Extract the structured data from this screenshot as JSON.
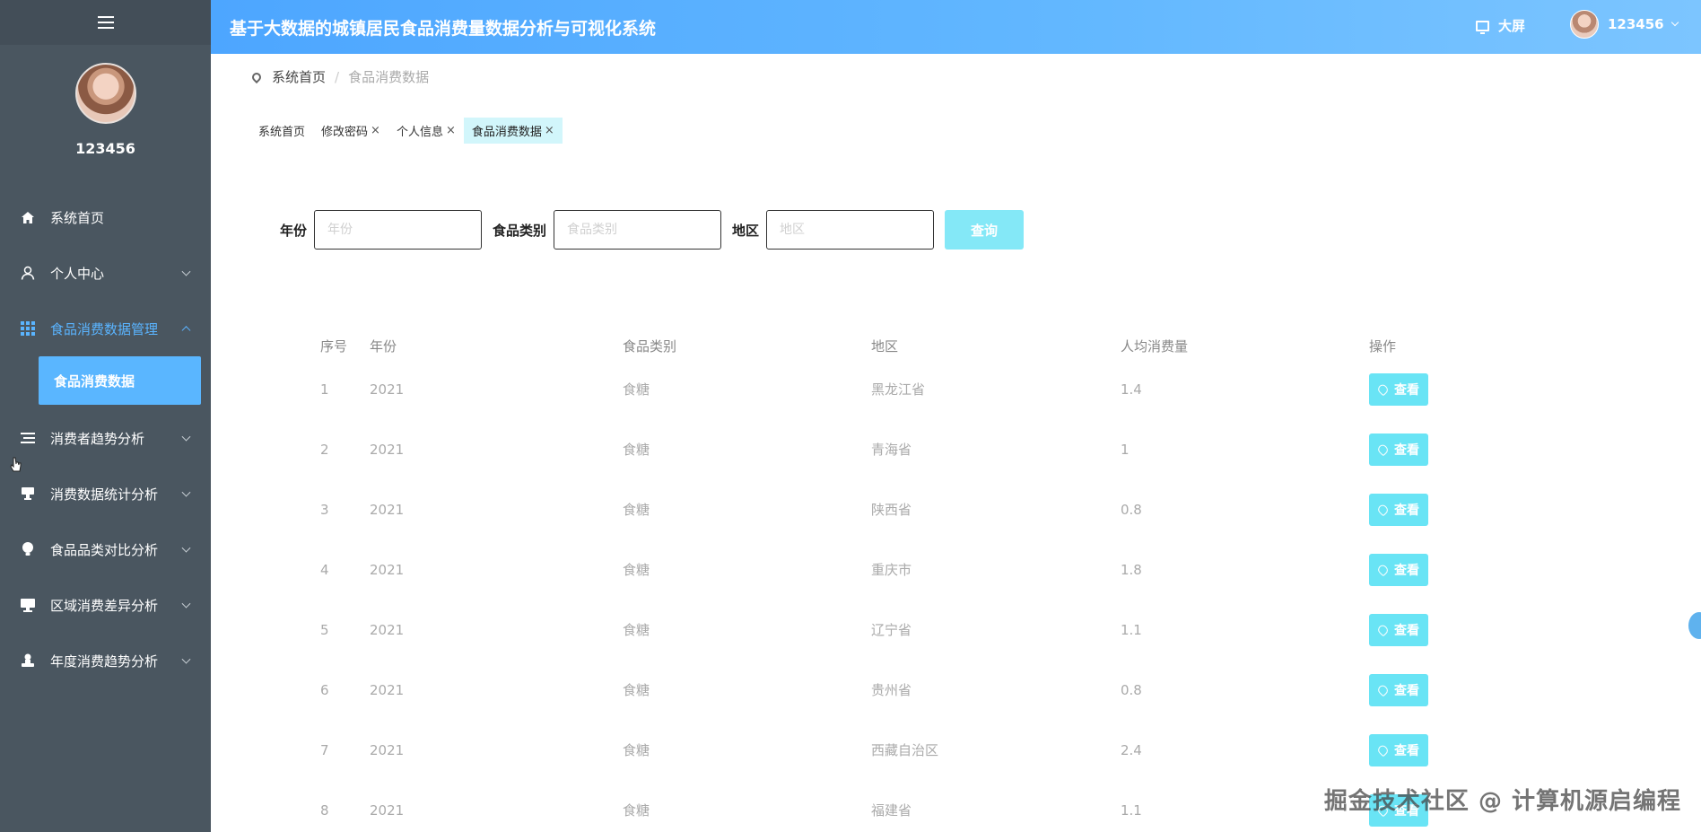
{
  "header": {
    "title": "基于大数据的城镇居民食品消费量数据分析与可视化系统",
    "screen_label": "大屏",
    "user_label": "123456"
  },
  "sidebar": {
    "username": "123456",
    "items": [
      {
        "label": "系统首页",
        "icon": "home-icon"
      },
      {
        "label": "个人中心",
        "icon": "user-icon"
      },
      {
        "label": "食品消费数据管理",
        "icon": "grid-icon"
      },
      {
        "label": "消费者趋势分析",
        "icon": "list-icon"
      },
      {
        "label": "消费数据统计分析",
        "icon": "stamp-icon"
      },
      {
        "label": "食品品类对比分析",
        "icon": "bulb-icon"
      },
      {
        "label": "区域消费差异分析",
        "icon": "monitor-icon"
      },
      {
        "label": "年度消费趋势分析",
        "icon": "person-stamp-icon"
      }
    ],
    "sub_item": "食品消费数据"
  },
  "breadcrumb": {
    "home": "系统首页",
    "current": "食品消费数据"
  },
  "tags": [
    {
      "label": "系统首页"
    },
    {
      "label": "修改密码"
    },
    {
      "label": "个人信息"
    },
    {
      "label": "食品消费数据"
    }
  ],
  "tag_close": "×",
  "search": {
    "year_label": "年份",
    "year_placeholder": "年份",
    "category_label": "食品类别",
    "category_placeholder": "食品类别",
    "region_label": "地区",
    "region_placeholder": "地区",
    "button": "查询"
  },
  "table": {
    "headers": [
      "序号",
      "年份",
      "食品类别",
      "地区",
      "人均消费量",
      "操作"
    ],
    "rows": [
      [
        "1",
        "2021",
        "食糖",
        "黑龙江省",
        "1.4"
      ],
      [
        "2",
        "2021",
        "食糖",
        "青海省",
        "1"
      ],
      [
        "3",
        "2021",
        "食糖",
        "陕西省",
        "0.8"
      ],
      [
        "4",
        "2021",
        "食糖",
        "重庆市",
        "1.8"
      ],
      [
        "5",
        "2021",
        "食糖",
        "辽宁省",
        "1.1"
      ],
      [
        "6",
        "2021",
        "食糖",
        "贵州省",
        "0.8"
      ],
      [
        "7",
        "2021",
        "食糖",
        "西藏自治区",
        "2.4"
      ],
      [
        "8",
        "2021",
        "食糖",
        "福建省",
        "1.1"
      ]
    ],
    "view_label": "查看"
  },
  "watermark": "掘金技术社区 @ 计算机源启编程"
}
